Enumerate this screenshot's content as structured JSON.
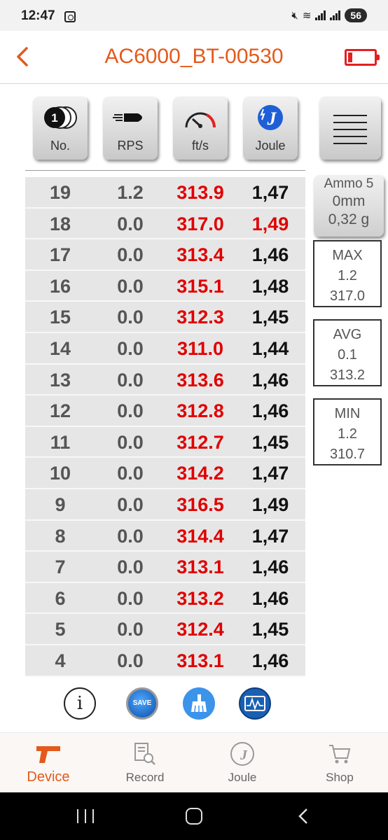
{
  "status_bar": {
    "time": "12:47",
    "battery": "56"
  },
  "header": {
    "title": "AC6000_BT-00530"
  },
  "columns": [
    {
      "label": "No.",
      "icon": "shots-icon"
    },
    {
      "label": "RPS",
      "icon": "bullet-icon"
    },
    {
      "label": "ft/s",
      "icon": "speedometer-icon"
    },
    {
      "label": "Joule",
      "icon": "joule-icon"
    }
  ],
  "rows": [
    {
      "no": "19",
      "rps": "1.2",
      "fps": "313.9",
      "joule": "1,47",
      "joule_highlight": false
    },
    {
      "no": "18",
      "rps": "0.0",
      "fps": "317.0",
      "joule": "1,49",
      "joule_highlight": true
    },
    {
      "no": "17",
      "rps": "0.0",
      "fps": "313.4",
      "joule": "1,46",
      "joule_highlight": false
    },
    {
      "no": "16",
      "rps": "0.0",
      "fps": "315.1",
      "joule": "1,48",
      "joule_highlight": false
    },
    {
      "no": "15",
      "rps": "0.0",
      "fps": "312.3",
      "joule": "1,45",
      "joule_highlight": false
    },
    {
      "no": "14",
      "rps": "0.0",
      "fps": "311.0",
      "joule": "1,44",
      "joule_highlight": false
    },
    {
      "no": "13",
      "rps": "0.0",
      "fps": "313.6",
      "joule": "1,46",
      "joule_highlight": false
    },
    {
      "no": "12",
      "rps": "0.0",
      "fps": "312.8",
      "joule": "1,46",
      "joule_highlight": false
    },
    {
      "no": "11",
      "rps": "0.0",
      "fps": "312.7",
      "joule": "1,45",
      "joule_highlight": false
    },
    {
      "no": "10",
      "rps": "0.0",
      "fps": "314.2",
      "joule": "1,47",
      "joule_highlight": false
    },
    {
      "no": "9",
      "rps": "0.0",
      "fps": "316.5",
      "joule": "1,49",
      "joule_highlight": false
    },
    {
      "no": "8",
      "rps": "0.0",
      "fps": "314.4",
      "joule": "1,47",
      "joule_highlight": false
    },
    {
      "no": "7",
      "rps": "0.0",
      "fps": "313.1",
      "joule": "1,46",
      "joule_highlight": false
    },
    {
      "no": "6",
      "rps": "0.0",
      "fps": "313.2",
      "joule": "1,46",
      "joule_highlight": false
    },
    {
      "no": "5",
      "rps": "0.0",
      "fps": "312.4",
      "joule": "1,45",
      "joule_highlight": false
    },
    {
      "no": "4",
      "rps": "0.0",
      "fps": "313.1",
      "joule": "1,46",
      "joule_highlight": false
    }
  ],
  "ammo": {
    "line1": "Ammo 5",
    "line2": "0mm",
    "line3": "0,32 g"
  },
  "stats": {
    "max": {
      "title": "MAX",
      "rps": "1.2",
      "fps": "317.0"
    },
    "avg": {
      "title": "AVG",
      "rps": "0.1",
      "fps": "313.2"
    },
    "min": {
      "title": "MIN",
      "rps": "1.2",
      "fps": "310.7"
    }
  },
  "actions": {
    "info": "i",
    "save": "SAVE"
  },
  "bottom_nav": [
    {
      "label": "Device",
      "active": true
    },
    {
      "label": "Record",
      "active": false
    },
    {
      "label": "Joule",
      "active": false
    },
    {
      "label": "Shop",
      "active": false
    }
  ],
  "colors": {
    "accent": "#e35a1c",
    "value_red": "#e00000",
    "row_bg": "#e6e6e6"
  }
}
